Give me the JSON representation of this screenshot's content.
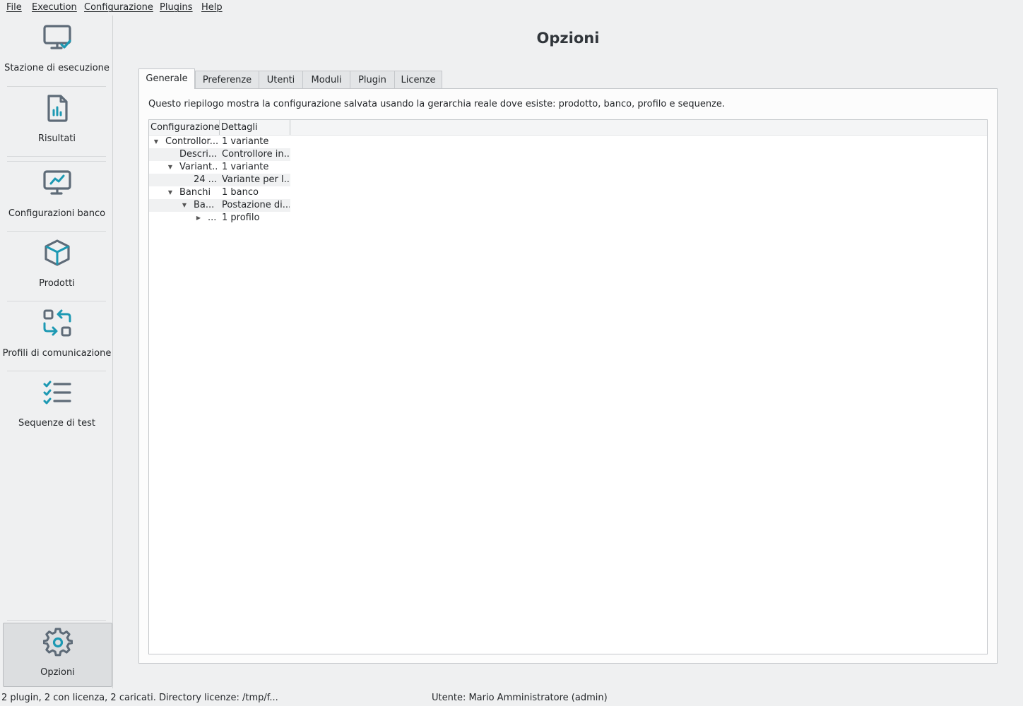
{
  "menu": [
    {
      "label": "File"
    },
    {
      "label": "Execution"
    },
    {
      "label": "Configurazione"
    },
    {
      "label": "Plugins"
    },
    {
      "label": "Help"
    }
  ],
  "sidebar": {
    "items": [
      {
        "label": "Stazione di esecuzione",
        "icon": "monitor-check-icon"
      },
      {
        "label": "Risultati",
        "icon": "report-document-icon"
      },
      {
        "label": "Configurazioni banco",
        "icon": "monitor-chart-icon"
      },
      {
        "label": "Prodotti",
        "icon": "box-icon"
      },
      {
        "label": "Profili di comunicazione",
        "icon": "swap-arrows-icon"
      },
      {
        "label": "Sequenze di test",
        "icon": "checklist-icon"
      }
    ],
    "options": {
      "label": "Opzioni",
      "icon": "gear-icon"
    }
  },
  "page": {
    "title": "Opzioni"
  },
  "tabs": [
    {
      "label": "Generale",
      "active": true
    },
    {
      "label": "Preferenze"
    },
    {
      "label": "Utenti"
    },
    {
      "label": "Moduli"
    },
    {
      "label": "Plugin"
    },
    {
      "label": "Licenze"
    }
  ],
  "general": {
    "description": "Questo riepilogo mostra la configurazione salvata usando la gerarchia reale dove esiste: prodotto, banco, profilo e sequenze.",
    "columns": [
      "Configurazione",
      "Dettagli"
    ],
    "rows": [
      {
        "name": "Controllor...",
        "details": "1 variante",
        "expander": "expanded"
      },
      {
        "name": "Descri...",
        "details": "Controllore in...",
        "expander": "none"
      },
      {
        "name": "Variant...",
        "details": "1 variante",
        "expander": "expanded"
      },
      {
        "name": "24 ...",
        "details": "Variante per l...",
        "expander": "none"
      },
      {
        "name": "Banchi",
        "details": "1 banco",
        "expander": "expanded"
      },
      {
        "name": "Ba...",
        "details": "Postazione di...",
        "expander": "expanded"
      },
      {
        "name": "...",
        "details": "1 profilo",
        "expander": "collapsed"
      }
    ]
  },
  "status": {
    "left": "2 plugin, 2 con licenza, 2 caricati. Directory licenze: /tmp/f...",
    "right": "Utente: Mario Amministratore (admin)"
  },
  "colors": {
    "accent": "#1d99b3",
    "icon_gray": "#5e6b78"
  }
}
